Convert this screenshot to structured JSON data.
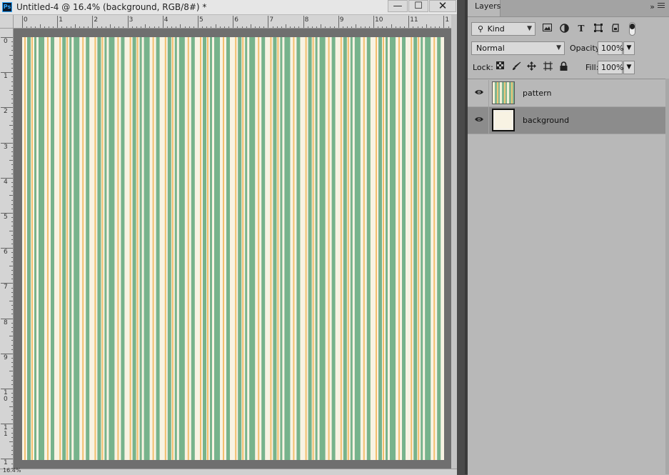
{
  "app": {
    "icon_label": "Ps",
    "document_title": "Untitled-4 @ 16.4% (background, RGB/8#) *",
    "window_controls": {
      "minimize": "—",
      "maximize": "☐",
      "close": "✕"
    }
  },
  "rulers": {
    "horizontal_labels": [
      "0",
      "1",
      "2",
      "3",
      "4",
      "5",
      "6",
      "7",
      "8",
      "9",
      "10",
      "11",
      "1"
    ],
    "vertical_labels": [
      "0",
      "1",
      "2",
      "3",
      "4",
      "5",
      "6",
      "7",
      "8",
      "9",
      "1\n0",
      "1\n1",
      "1"
    ]
  },
  "status": {
    "zoom": "16.4%"
  },
  "canvas": {
    "background_color": "#f8f3e3",
    "stripe_colors": {
      "green": "#77b38c",
      "orange": "#f2bf6e",
      "pale": "#faf6e6"
    }
  },
  "layers_panel": {
    "tab_label": "Layers",
    "collapse_icon": "»",
    "filter": {
      "kind_label": "Kind",
      "icons": [
        "image-filter-icon",
        "adjustment-filter-icon",
        "type-filter-icon",
        "shape-filter-icon",
        "smart-object-filter-icon"
      ]
    },
    "blend_mode": "Normal",
    "opacity_label": "Opacity:",
    "opacity_value": "100%",
    "lock_label": "Lock:",
    "lock_icons": [
      "lock-transparent-icon",
      "lock-image-icon",
      "lock-position-icon",
      "lock-artboard-icon",
      "lock-all-icon"
    ],
    "fill_label": "Fill:",
    "fill_value": "100%",
    "layers": [
      {
        "name": "pattern",
        "visible": true,
        "selected": false
      },
      {
        "name": "background",
        "visible": true,
        "selected": true
      }
    ]
  }
}
